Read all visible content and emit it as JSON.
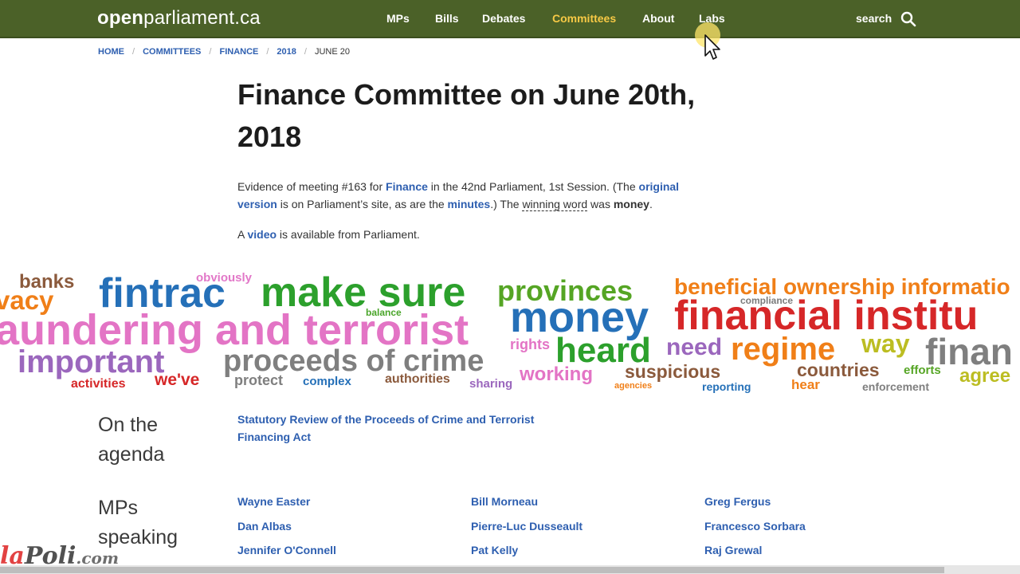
{
  "site": {
    "logo_bold": "open",
    "logo_thin": "parliament.ca"
  },
  "nav": {
    "items": [
      {
        "label": "MPs"
      },
      {
        "label": "Bills"
      },
      {
        "label": "Debates"
      },
      {
        "label": "Committees",
        "active": true
      },
      {
        "label": "About"
      },
      {
        "label": "Labs"
      }
    ],
    "search_label": "search",
    "search_icon": "search-icon",
    "active_color": "#f7c945",
    "bar_color": "#4b6128"
  },
  "breadcrumb": [
    "HOME",
    "COMMITTEES",
    "FINANCE",
    "2018",
    "JUNE 20"
  ],
  "page": {
    "title": "Finance Committee on June 20th, 2018",
    "evidence": {
      "t1": "Evidence of meeting #163 for ",
      "finance_link": "Finance",
      "t2": " in the 42nd Parliament, 1st Session. (The ",
      "original_link": "original version",
      "t3": " is on Parliament’s site, as are the ",
      "minutes_link": "minutes",
      "t4": ".) The ",
      "winning_word_label": "winning word",
      "t5": " was ",
      "winning_word": "money",
      "t6": "."
    },
    "video": {
      "t1": "A ",
      "link": "video",
      "t2": " is available from Parliament."
    }
  },
  "wordcloud": [
    "banks",
    "vacy",
    "obviously",
    "fintrac",
    "make sure",
    "provinces",
    "beneficial ownership informatio",
    "compliance",
    "aundering and terrorist",
    "balance",
    "money",
    "financial institu",
    "important",
    "rights",
    "heard",
    "need",
    "regime",
    "way",
    "finan",
    "proceeds of crime",
    "suspicious",
    "countries",
    "efforts",
    "agree",
    "activities",
    "we've",
    "protect",
    "complex",
    "authorities",
    "sharing",
    "working",
    "agencies",
    "reporting",
    "hear",
    "enforcement"
  ],
  "agenda": {
    "label": "On the agenda",
    "item": "Statutory Review of the Proceeds of Crime and Terrorist Financing Act"
  },
  "mps": {
    "label": "MPs speaking",
    "names": [
      "Wayne Easter",
      "Bill Morneau",
      "Greg Fergus",
      "Dan Albas",
      "Pierre-Luc Dusseault",
      "Francesco Sorbara",
      "Jennifer O'Connell",
      "Pat Kelly",
      "Raj Grewal"
    ]
  },
  "watermark": {
    "red": "la",
    "dark": "Poli",
    "small": ".com"
  }
}
